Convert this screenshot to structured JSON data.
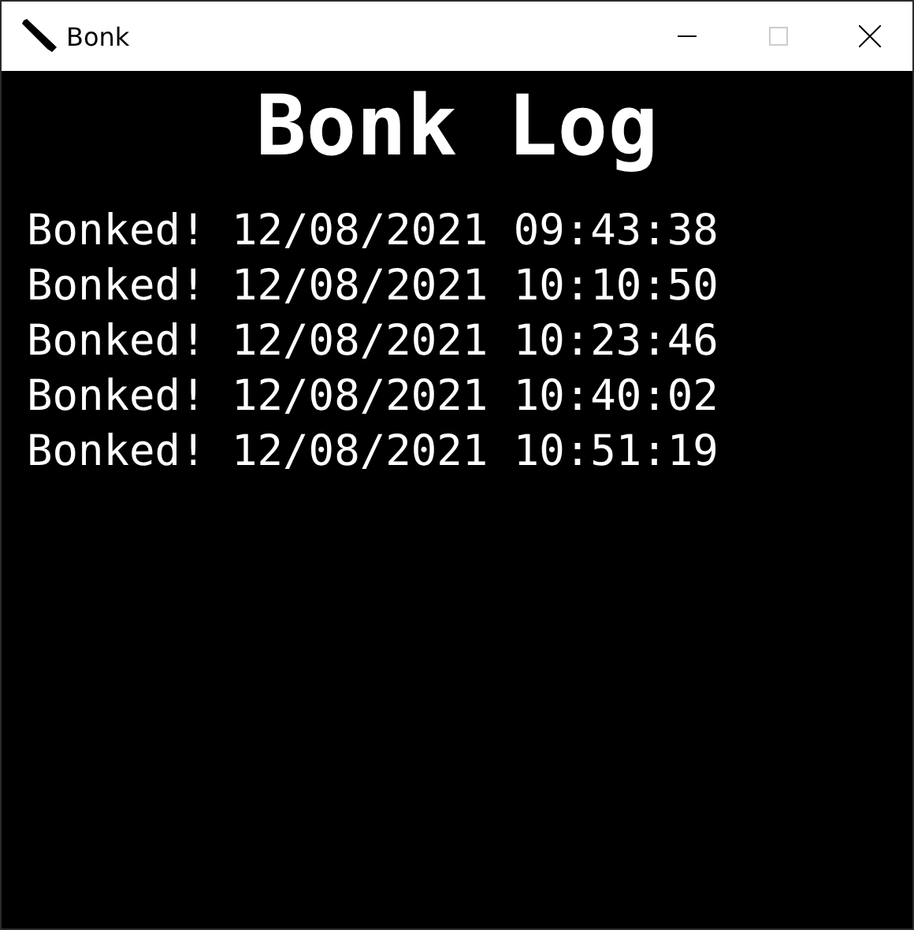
{
  "window": {
    "title": "Bonk",
    "maximize_disabled": true
  },
  "heading": "Bonk Log",
  "log": [
    "Bonked! 12/08/2021 09:43:38",
    "Bonked! 12/08/2021 10:10:50",
    "Bonked! 12/08/2021 10:23:46",
    "Bonked! 12/08/2021 10:40:02",
    "Bonked! 12/08/2021 10:51:19"
  ]
}
